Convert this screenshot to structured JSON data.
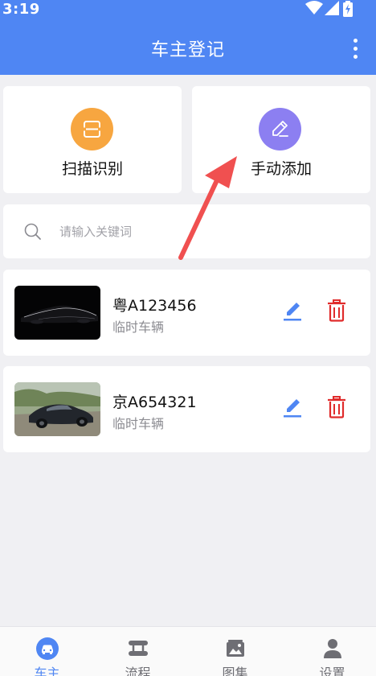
{
  "status_bar": {
    "time": "3:19"
  },
  "header": {
    "title": "车主登记"
  },
  "actions": [
    {
      "label": "扫描识别",
      "icon": "scan-icon",
      "color": "#f7a640"
    },
    {
      "label": "手动添加",
      "icon": "pencil-icon",
      "color": "#8c7ff1"
    }
  ],
  "search": {
    "placeholder": "请输入关键词",
    "value": ""
  },
  "vehicles": [
    {
      "plate": "粤A123456",
      "type": "临时车辆"
    },
    {
      "plate": "京A654321",
      "type": "临时车辆"
    }
  ],
  "tabs": [
    {
      "label": "车主",
      "icon": "car-icon",
      "active": true
    },
    {
      "label": "流程",
      "icon": "flow-icon",
      "active": false
    },
    {
      "label": "图集",
      "icon": "gallery-icon",
      "active": false
    },
    {
      "label": "设置",
      "icon": "user-icon",
      "active": false
    }
  ],
  "colors": {
    "primary": "#4f86f3",
    "edit": "#4f86f3",
    "delete": "#e02b2b",
    "annotation_arrow": "#f05050"
  }
}
